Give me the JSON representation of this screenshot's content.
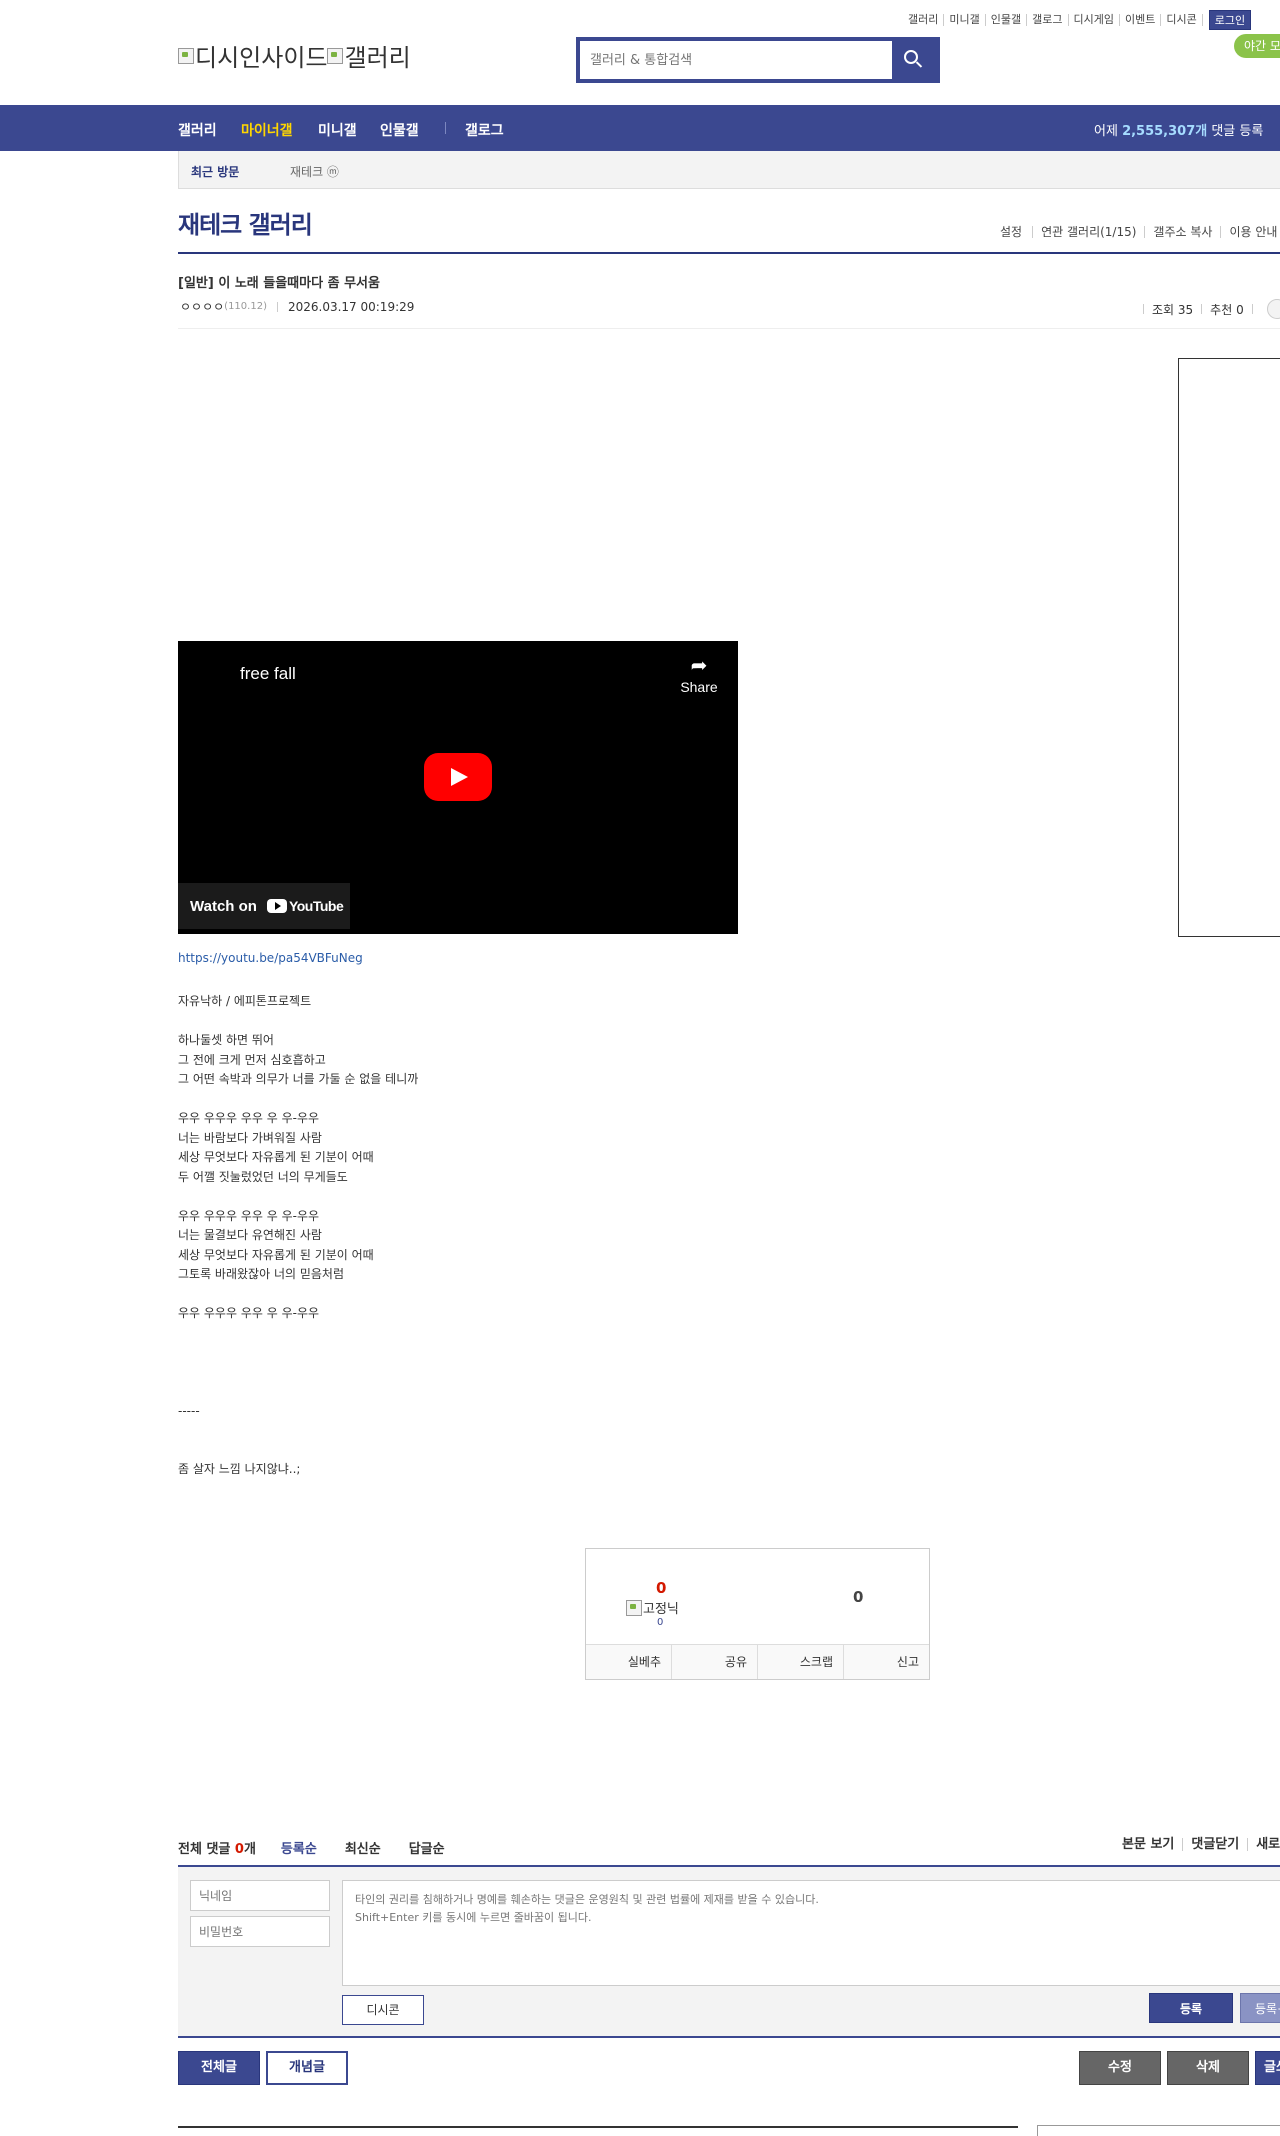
{
  "util_nav": {
    "items": [
      "갤러리",
      "미니갤",
      "인물갤",
      "갤로그",
      "디시게임",
      "이벤트",
      "디시콘"
    ],
    "login": "로그인",
    "night_mode": "야간 모드"
  },
  "logo": {
    "site": "디시인사이드",
    "section": "갤러리"
  },
  "search": {
    "placeholder": "갤러리 & 통합검색"
  },
  "gnb": {
    "items": [
      "갤러리",
      "마이너갤",
      "미니갤",
      "인물갤",
      "갤로그"
    ],
    "stat_prefix": "어제 ",
    "stat_count": "2,555,307개",
    "stat_suffix": " 댓글 등록"
  },
  "lnb": {
    "recent_tab": "최근 방문",
    "recent_item": "재테크 ⓜ"
  },
  "gallery": {
    "title": "재테크 갤러리",
    "options": [
      "설정",
      "연관 갤러리(1/15)",
      "갤주소 복사",
      "이용 안내"
    ]
  },
  "post": {
    "title": "[일반] 이 노래 들을때마다 좀 무서움",
    "author": "ㅇㅇㅇㅇ",
    "ip": "(110.12)",
    "date": "2026.03.17 00:19:29",
    "views": "조회 35",
    "recommends": "추천 0",
    "video": {
      "title": "free fall",
      "share": "Share",
      "watch_on": "Watch on",
      "youtube": "YouTube"
    },
    "link": "https://youtu.be/pa54VBFuNeg",
    "body": "자유낙하 / 에피톤프로젝트\n\n하나둘셋 하면 뛰어\n그 전에 크게 먼저 심호흡하고\n그 어떤 속박과 의무가 너를 가둘 순 없을 테니까\n\n우우 우우우 우우 우 우-우우\n너는 바람보다 가벼워질 사람\n세상 무엇보다 자유롭게 된 기분이 어때\n두 어깰 짓눌렀었던 너의 무게들도\n\n우우 우우우 우우 우 우-우우\n너는 물결보다 유연해진 사람\n세상 무엇보다 자유롭게 된 기분이 어때\n그토록 바래왔잖아 너의 믿음처럼\n\n우우 우우우 우우 우 우-우우\n\n\n\n\n-----\n\n\n좀 살자 느낌 나지않냐..;"
  },
  "recommend": {
    "up_count": "0",
    "fixed_label": "고정닉",
    "fixed_count": "0",
    "down_count": "0",
    "buttons": [
      "실베추",
      "공유",
      "스크랩",
      "신고"
    ]
  },
  "comments": {
    "total_label": "전체 댓글 ",
    "total_count": "0",
    "total_unit": "개",
    "sorts": [
      "등록순",
      "최신순",
      "답글순"
    ],
    "right_links": [
      "본문 보기",
      "댓글닫기",
      "새로고침"
    ],
    "nickname_placeholder": "닉네임",
    "password_placeholder": "비밀번호",
    "textarea_placeholder": "타인의 권리를 침해하거나 명예를 훼손하는 댓글은 운영원칙 및 관련 법률에 제재를 받을 수 있습니다.\nShift+Enter 키를 동시에 누르면 줄바꿈이 됩니다.",
    "dccon": "디시콘",
    "submit": "등록",
    "submit_recommend": "등록+추천"
  },
  "bottom_buttons": {
    "all": "전체글",
    "concept": "개념글",
    "edit": "수정",
    "delete": "삭제",
    "write": "글쓰기"
  }
}
